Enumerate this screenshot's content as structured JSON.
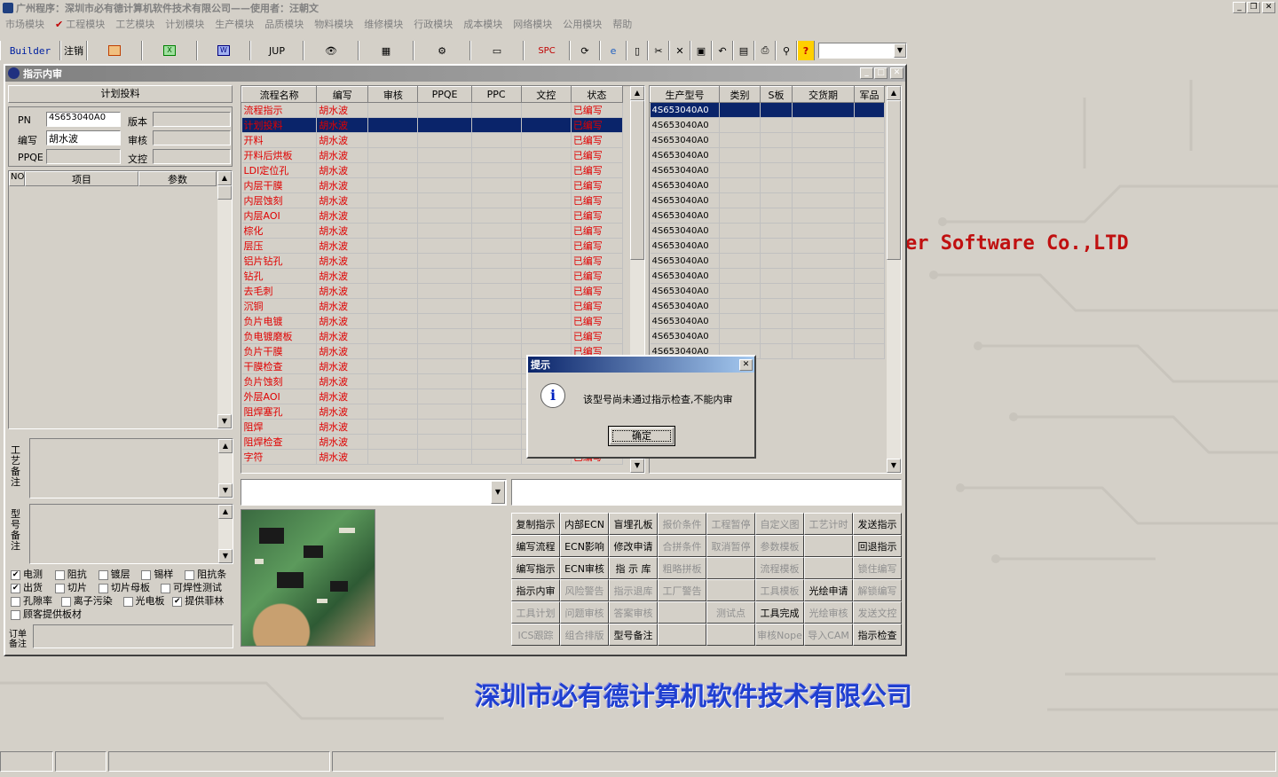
{
  "app": {
    "title": "广州程序：深圳市必有德计算机软件技术有限公司——使用者：汪朝文"
  },
  "menu": {
    "items": [
      "市场模块",
      "工程模块",
      "工艺模块",
      "计划模块",
      "生产模块",
      "品质模块",
      "物料模块",
      "维修模块",
      "行政模块",
      "成本模块",
      "网络模块",
      "公用模块",
      "帮助"
    ]
  },
  "toolbar": {
    "builder": "Builder",
    "logout": "注销",
    "jup": "JUP",
    "spc": "SPC"
  },
  "background": {
    "software_text": "er Software Co.,LTD",
    "company": "深圳市必有德计算机软件技术有限公司"
  },
  "window": {
    "title": "指示内审"
  },
  "left": {
    "section_title": "计划投料",
    "pn_label": "PN",
    "pn_value": "4S653040A0",
    "version_label": "版本",
    "version_value": "",
    "writer_label": "编写",
    "writer_value": "胡水波",
    "review_label": "审核",
    "review_value": "",
    "ppqe_label": "PPQE",
    "ppqe_value": "",
    "doc_label": "文控",
    "doc_value": "",
    "param_headers": [
      "NO",
      "项目",
      "参数"
    ],
    "craft_note_label": "工艺备注",
    "model_note_label": "型号备注",
    "order_note_label": "订单备注",
    "checkboxes": [
      {
        "label": "电测",
        "checked": true
      },
      {
        "label": "阻抗",
        "checked": false
      },
      {
        "label": "镀层",
        "checked": false
      },
      {
        "label": "锡样",
        "checked": false
      },
      {
        "label": "阻抗条",
        "checked": false
      },
      {
        "label": "出货",
        "checked": true
      },
      {
        "label": "切片",
        "checked": false
      },
      {
        "label": "切片母板",
        "checked": false
      },
      {
        "label": "可焊性测试",
        "checked": false
      },
      {
        "label": "孔隙率",
        "checked": false
      },
      {
        "label": "离子污染",
        "checked": false
      },
      {
        "label": "光电板",
        "checked": false
      },
      {
        "label": "提供菲林",
        "checked": true
      },
      {
        "label": "顾客提供板材",
        "checked": false
      }
    ]
  },
  "flow": {
    "headers": [
      "流程名称",
      "编写",
      "审核",
      "PPQE",
      "PPC",
      "文控",
      "状态"
    ],
    "rows": [
      {
        "name": "流程指示",
        "writer": "胡水波",
        "status": "已编写"
      },
      {
        "name": "计划投料",
        "writer": "胡水波",
        "status": "已编写",
        "selected": true
      },
      {
        "name": "开料",
        "writer": "胡水波",
        "status": "已编写"
      },
      {
        "name": "开料后烘板",
        "writer": "胡水波",
        "status": "已编写"
      },
      {
        "name": "LDI定位孔",
        "writer": "胡水波",
        "status": "已编写"
      },
      {
        "name": "内层干膜",
        "writer": "胡水波",
        "status": "已编写"
      },
      {
        "name": "内层蚀刻",
        "writer": "胡水波",
        "status": "已编写"
      },
      {
        "name": "内层AOI",
        "writer": "胡水波",
        "status": "已编写"
      },
      {
        "name": "棕化",
        "writer": "胡水波",
        "status": "已编写"
      },
      {
        "name": "层压",
        "writer": "胡水波",
        "status": "已编写"
      },
      {
        "name": "铝片钻孔",
        "writer": "胡水波",
        "status": "已编写"
      },
      {
        "name": "钻孔",
        "writer": "胡水波",
        "status": "已编写"
      },
      {
        "name": "去毛刺",
        "writer": "胡水波",
        "status": "已编写"
      },
      {
        "name": "沉铜",
        "writer": "胡水波",
        "status": "已编写"
      },
      {
        "name": "负片电镀",
        "writer": "胡水波",
        "status": "已编写"
      },
      {
        "name": "负电镀磨板",
        "writer": "胡水波",
        "status": "已编写"
      },
      {
        "name": "负片干膜",
        "writer": "胡水波",
        "status": "已编写"
      },
      {
        "name": "干膜检查",
        "writer": "胡水波",
        "status": ""
      },
      {
        "name": "负片蚀刻",
        "writer": "胡水波",
        "status": ""
      },
      {
        "name": "外层AOI",
        "writer": "胡水波",
        "status": ""
      },
      {
        "name": "阻焊塞孔",
        "writer": "胡水波",
        "status": ""
      },
      {
        "name": "阻焊",
        "writer": "胡水波",
        "status": ""
      },
      {
        "name": "阻焊检查",
        "writer": "胡水波",
        "status": ""
      },
      {
        "name": "字符",
        "writer": "胡水波",
        "status": "已编写"
      }
    ]
  },
  "models": {
    "headers": [
      "生产型号",
      "类别",
      "S板",
      "交货期",
      "军品"
    ],
    "rows": [
      "4S653040A0",
      "4S653040A0",
      "4S653040A0",
      "4S653040A0",
      "4S653040A0",
      "4S653040A0",
      "4S653040A0",
      "4S653040A0",
      "4S653040A0",
      "4S653040A0",
      "4S653040A0",
      "4S653040A0",
      "4S653040A0",
      "4S653040A0",
      "4S653040A0",
      "4S653040A0",
      "4S653040A0"
    ]
  },
  "buttons": [
    {
      "label": "复制指示",
      "enabled": true
    },
    {
      "label": "内部ECN",
      "enabled": true
    },
    {
      "label": "盲埋孔板",
      "enabled": true
    },
    {
      "label": "报价条件",
      "enabled": false
    },
    {
      "label": "工程暂停",
      "enabled": false
    },
    {
      "label": "自定义图",
      "enabled": false
    },
    {
      "label": "工艺计时",
      "enabled": false
    },
    {
      "label": "发送指示",
      "enabled": true
    },
    {
      "label": "编写流程",
      "enabled": true
    },
    {
      "label": "ECN影响",
      "enabled": true
    },
    {
      "label": "修改申请",
      "enabled": true
    },
    {
      "label": "合拼条件",
      "enabled": false
    },
    {
      "label": "取消暂停",
      "enabled": false
    },
    {
      "label": "参数模板",
      "enabled": false
    },
    {
      "label": "",
      "enabled": false
    },
    {
      "label": "回退指示",
      "enabled": true
    },
    {
      "label": "编写指示",
      "enabled": true
    },
    {
      "label": "ECN审核",
      "enabled": true
    },
    {
      "label": "指 示 库",
      "enabled": true
    },
    {
      "label": "粗略拼板",
      "enabled": false
    },
    {
      "label": "",
      "enabled": false
    },
    {
      "label": "流程模板",
      "enabled": false
    },
    {
      "label": "",
      "enabled": false
    },
    {
      "label": "锁住编写",
      "enabled": false
    },
    {
      "label": "指示内审",
      "enabled": true
    },
    {
      "label": "风险警告",
      "enabled": false
    },
    {
      "label": "指示退库",
      "enabled": false
    },
    {
      "label": "工厂警告",
      "enabled": false
    },
    {
      "label": "",
      "enabled": false
    },
    {
      "label": "工具模板",
      "enabled": false
    },
    {
      "label": "光绘申请",
      "enabled": true
    },
    {
      "label": "解锁编写",
      "enabled": false
    },
    {
      "label": "工具计划",
      "enabled": false
    },
    {
      "label": "问题审核",
      "enabled": false
    },
    {
      "label": "答案审核",
      "enabled": false
    },
    {
      "label": "",
      "enabled": false
    },
    {
      "label": "测试点",
      "enabled": false
    },
    {
      "label": "工具完成",
      "enabled": true
    },
    {
      "label": "光绘审核",
      "enabled": false
    },
    {
      "label": "发送文控",
      "enabled": false
    },
    {
      "label": "ICS跟踪",
      "enabled": false
    },
    {
      "label": "组合排版",
      "enabled": false
    },
    {
      "label": "型号备注",
      "enabled": true
    },
    {
      "label": "",
      "enabled": false
    },
    {
      "label": "",
      "enabled": false
    },
    {
      "label": "审核Nope",
      "enabled": false
    },
    {
      "label": "导入CAM",
      "enabled": false
    },
    {
      "label": "指示检查",
      "enabled": true
    }
  ],
  "dialog": {
    "title": "提示",
    "message": "该型号尚未通过指示检查,不能内审",
    "ok": "确定"
  }
}
